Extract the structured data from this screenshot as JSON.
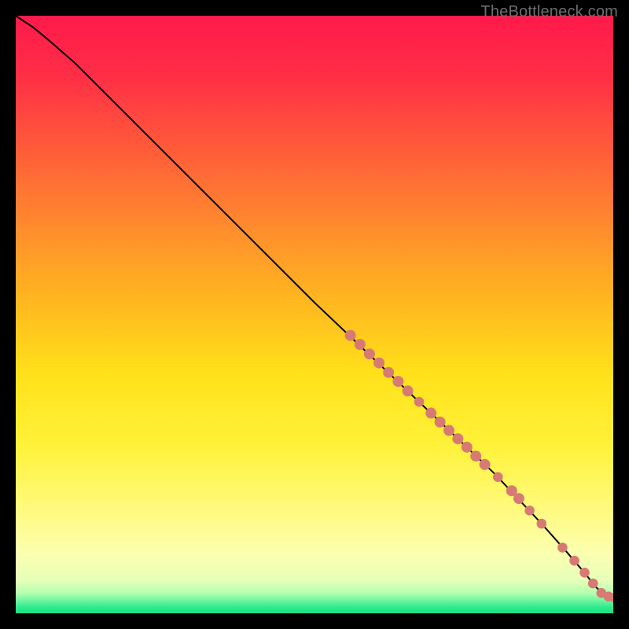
{
  "watermark": "TheBottleneck.com",
  "gradient": {
    "stops": [
      {
        "offset": 0.0,
        "color": "#ff1a4b"
      },
      {
        "offset": 0.1,
        "color": "#ff2e46"
      },
      {
        "offset": 0.22,
        "color": "#ff5a3a"
      },
      {
        "offset": 0.35,
        "color": "#ff8a2e"
      },
      {
        "offset": 0.48,
        "color": "#ffb81f"
      },
      {
        "offset": 0.6,
        "color": "#ffe11a"
      },
      {
        "offset": 0.72,
        "color": "#fff23a"
      },
      {
        "offset": 0.82,
        "color": "#fffa7a"
      },
      {
        "offset": 0.9,
        "color": "#fbffb0"
      },
      {
        "offset": 0.945,
        "color": "#e6ffb8"
      },
      {
        "offset": 0.965,
        "color": "#b8ffb0"
      },
      {
        "offset": 0.978,
        "color": "#74f5a0"
      },
      {
        "offset": 0.99,
        "color": "#2fe98e"
      },
      {
        "offset": 1.0,
        "color": "#17e286"
      }
    ]
  },
  "curve_color": "#000000",
  "marker_color": "#d77a73",
  "chart_data": {
    "type": "line",
    "title": "",
    "xlabel": "",
    "ylabel": "",
    "xlim": [
      0,
      100
    ],
    "ylim": [
      0,
      100
    ],
    "grid": false,
    "series": [
      {
        "name": "curve",
        "style": "line",
        "x": [
          0,
          3,
          6,
          10,
          20,
          30,
          40,
          50,
          60,
          70,
          80,
          88,
          92,
          95,
          97,
          98.5,
          100
        ],
        "y": [
          100,
          98,
          95.5,
          92,
          82,
          72,
          62,
          52,
          42.5,
          33,
          23.5,
          15,
          10.5,
          7,
          4.5,
          3.0,
          2.6
        ]
      },
      {
        "name": "markers",
        "style": "scatter",
        "points": [
          {
            "x": 56.0,
            "y": 46.5,
            "r": 5
          },
          {
            "x": 57.6,
            "y": 45.0,
            "r": 5
          },
          {
            "x": 59.2,
            "y": 43.4,
            "r": 5
          },
          {
            "x": 60.8,
            "y": 41.9,
            "r": 5
          },
          {
            "x": 62.4,
            "y": 40.3,
            "r": 5
          },
          {
            "x": 64.0,
            "y": 38.8,
            "r": 5
          },
          {
            "x": 65.6,
            "y": 37.2,
            "r": 5
          },
          {
            "x": 67.5,
            "y": 35.4,
            "r": 4.5
          },
          {
            "x": 69.5,
            "y": 33.5,
            "r": 5
          },
          {
            "x": 71.0,
            "y": 32.0,
            "r": 5
          },
          {
            "x": 72.5,
            "y": 30.6,
            "r": 5
          },
          {
            "x": 74.0,
            "y": 29.2,
            "r": 5
          },
          {
            "x": 75.5,
            "y": 27.8,
            "r": 5
          },
          {
            "x": 77.0,
            "y": 26.3,
            "r": 5
          },
          {
            "x": 78.5,
            "y": 24.9,
            "r": 5
          },
          {
            "x": 80.7,
            "y": 22.8,
            "r": 4.5
          },
          {
            "x": 83.0,
            "y": 20.5,
            "r": 5
          },
          {
            "x": 84.2,
            "y": 19.2,
            "r": 5
          },
          {
            "x": 86.0,
            "y": 17.2,
            "r": 4.5
          },
          {
            "x": 88.0,
            "y": 15.0,
            "r": 4.5
          },
          {
            "x": 91.5,
            "y": 11.0,
            "r": 4.5
          },
          {
            "x": 93.5,
            "y": 8.8,
            "r": 4.5
          },
          {
            "x": 95.2,
            "y": 6.8,
            "r": 4.5
          },
          {
            "x": 96.6,
            "y": 5.0,
            "r": 4.5
          },
          {
            "x": 98.0,
            "y": 3.4,
            "r": 4.5
          },
          {
            "x": 99.2,
            "y": 2.8,
            "r": 4.5
          },
          {
            "x": 100.2,
            "y": 2.6,
            "r": 4.5
          }
        ]
      }
    ]
  }
}
